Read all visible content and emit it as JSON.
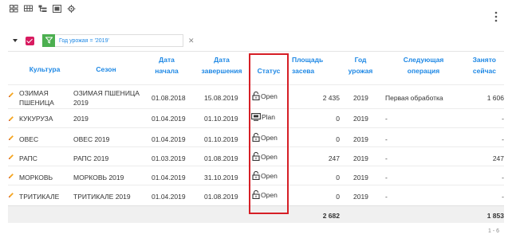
{
  "toolbar": {
    "icons": [
      "grid-view-icon",
      "table-view-icon",
      "tree-view-icon",
      "export-icon",
      "settings-icon"
    ]
  },
  "filter": {
    "text": "Год урожая = '2019'"
  },
  "columns": [
    {
      "label": "Культура"
    },
    {
      "label": "Сезон"
    },
    {
      "label": "Дата начала"
    },
    {
      "label": "Дата завершения"
    },
    {
      "label": "Статус"
    },
    {
      "label": "Площадь засева"
    },
    {
      "label": "Год урожая"
    },
    {
      "label": "Следующая операция"
    },
    {
      "label": "Занято сейчас"
    }
  ],
  "rows": [
    {
      "culture": "ОЗИМАЯ ПШЕНИЦА",
      "season": "ОЗИМАЯ ПШЕНИЦА 2019",
      "start": "01.08.2018",
      "end": "15.08.2019",
      "status": "Open",
      "status_icon": "lock-open-icon",
      "area": "2 435",
      "year": "2019",
      "next_op": "Первая обработка",
      "occupied": "1 606"
    },
    {
      "culture": "КУКУРУЗА",
      "season": "2019",
      "start": "01.04.2019",
      "end": "01.10.2019",
      "status": "Plan",
      "status_icon": "plan-icon",
      "area": "0",
      "year": "2019",
      "next_op": "-",
      "occupied": "-"
    },
    {
      "culture": "ОВЕС",
      "season": "ОВЕС 2019",
      "start": "01.04.2019",
      "end": "01.10.2019",
      "status": "Open",
      "status_icon": "lock-open-icon",
      "area": "0",
      "year": "2019",
      "next_op": "-",
      "occupied": "-"
    },
    {
      "culture": "РАПС",
      "season": "РАПС 2019",
      "start": "01.03.2019",
      "end": "01.08.2019",
      "status": "Open",
      "status_icon": "lock-open-icon",
      "area": "247",
      "year": "2019",
      "next_op": "-",
      "occupied": "247"
    },
    {
      "culture": "МОРКОВЬ",
      "season": "МОРКОВЬ 2019",
      "start": "01.04.2019",
      "end": "31.10.2019",
      "status": "Open",
      "status_icon": "lock-open-icon",
      "area": "0",
      "year": "2019",
      "next_op": "-",
      "occupied": "-"
    },
    {
      "culture": "ТРИТИКАЛЕ",
      "season": "ТРИТИКАЛЕ 2019",
      "start": "01.04.2019",
      "end": "01.08.2019",
      "status": "Open",
      "status_icon": "lock-open-icon",
      "area": "0",
      "year": "2019",
      "next_op": "-",
      "occupied": "-"
    }
  ],
  "totals": {
    "area": "2 682",
    "occupied": "1 853"
  },
  "pager": {
    "text": "1 - 6"
  },
  "colors": {
    "accent": "#1e88e5",
    "highlight": "#d61f26",
    "filter_check": "#d81b60",
    "filter_funnel": "#4caf50",
    "edit_icon": "#f5a623"
  }
}
